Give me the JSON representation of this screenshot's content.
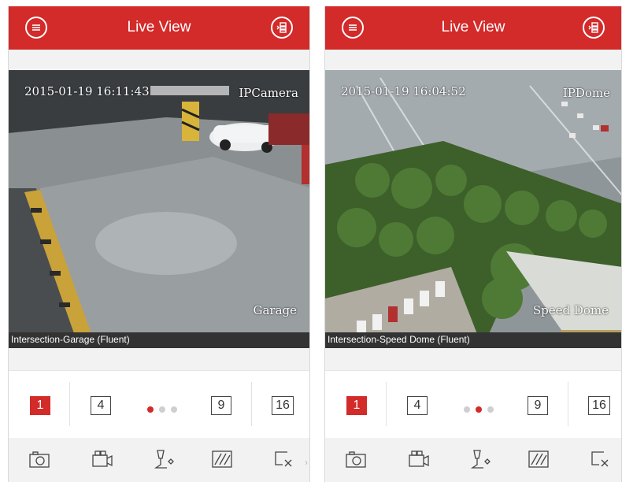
{
  "app": {
    "accent": "#d32a2a"
  },
  "left": {
    "title": "Live View",
    "timestamp": "2015-01-19 16:11:43",
    "camera_osd": "IPCamera",
    "location_osd": "Garage",
    "channel_label": "Intersection-Garage (Fluent)",
    "active_page_dot": 0
  },
  "right": {
    "title": "Live View",
    "timestamp": "2015-01-19 16:04:52",
    "camera_osd": "IPDome",
    "location_osd": "Speed Dome",
    "channel_label": "Intersection-Speed Dome (Fluent)",
    "active_page_dot": 1
  },
  "split_options": [
    "1",
    "4",
    "9",
    "16"
  ],
  "toolbar_icons": [
    "camera-snapshot-icon",
    "video-record-icon",
    "ptz-control-icon",
    "image-quality-icon",
    "close-window-icon"
  ],
  "icons": {
    "menu": "menu-icon",
    "layout": "layout-switch-icon"
  }
}
